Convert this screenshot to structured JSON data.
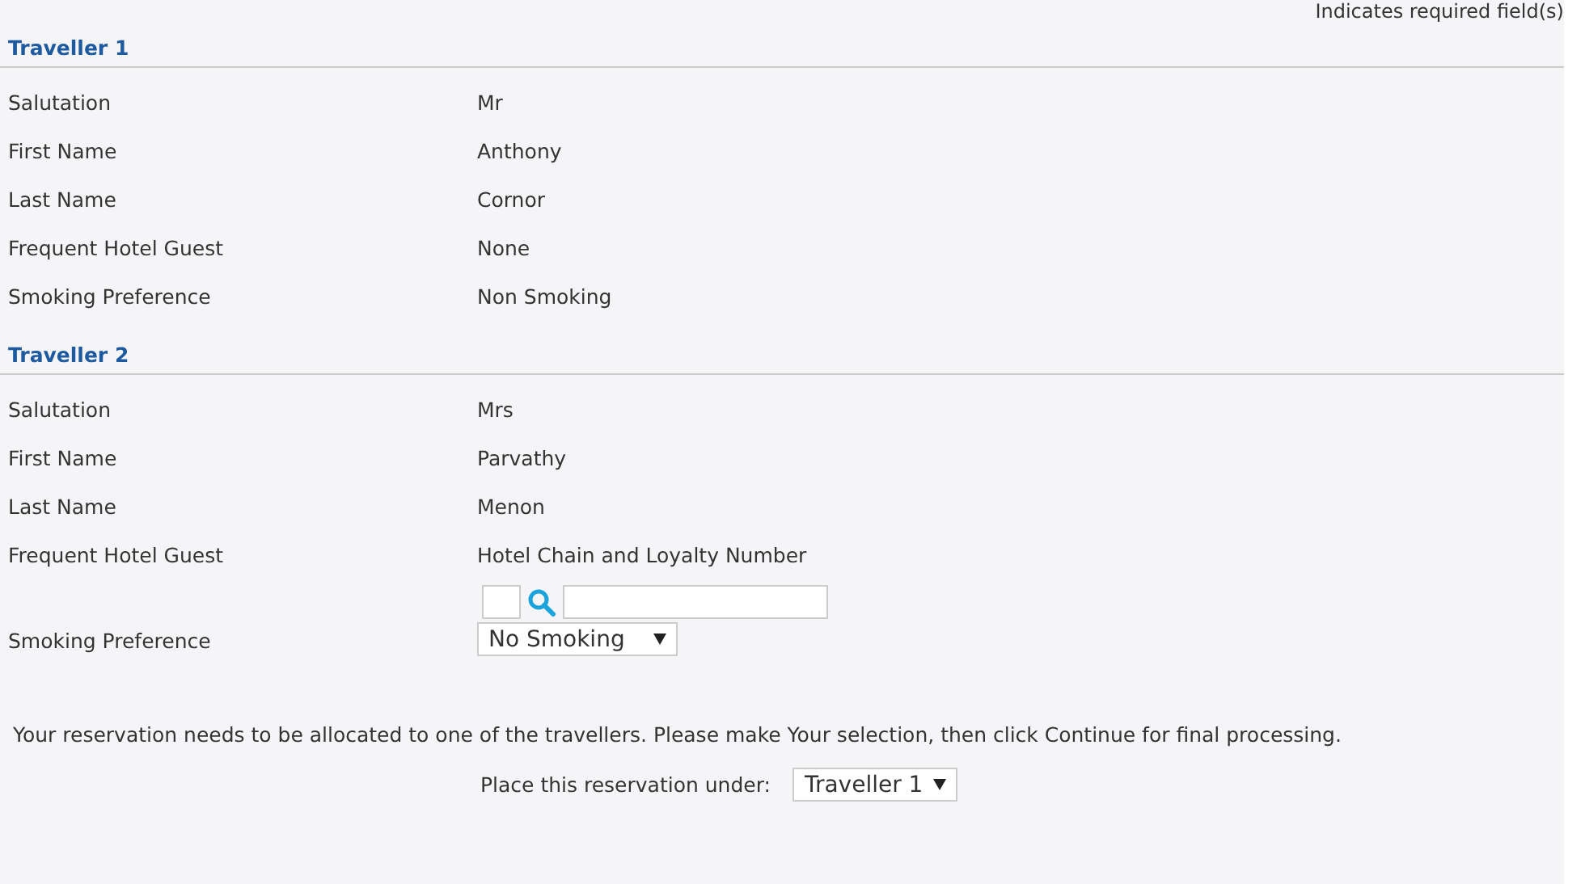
{
  "required_note": "Indicates required field(s)",
  "travellers": [
    {
      "title": "Traveller 1",
      "fields": [
        {
          "kind": "text",
          "label": "Salutation",
          "value": "Mr"
        },
        {
          "kind": "text",
          "label": "First Name",
          "value": "Anthony"
        },
        {
          "kind": "text",
          "label": "Last Name",
          "value": "Cornor"
        },
        {
          "kind": "text",
          "label": "Frequent Hotel Guest",
          "value": "None"
        },
        {
          "kind": "text",
          "label": "Smoking Preference",
          "value": "Non Smoking"
        }
      ]
    },
    {
      "title": "Traveller 2",
      "fields": [
        {
          "kind": "text",
          "label": "Salutation",
          "value": "Mrs"
        },
        {
          "kind": "text",
          "label": "First Name",
          "value": "Parvathy"
        },
        {
          "kind": "text",
          "label": "Last Name",
          "value": "Menon"
        },
        {
          "kind": "loyalty",
          "label": "Frequent Hotel Guest",
          "value": "Hotel Chain and Loyalty Number"
        },
        {
          "kind": "select",
          "label": "Smoking Preference",
          "value": "No Smoking"
        }
      ]
    }
  ],
  "instruction": "Your reservation needs to be allocated to one of the travellers. Please make Your selection, then click Continue for final processing.",
  "placement": {
    "label": "Place this reservation under:",
    "value": "Traveller 1"
  }
}
